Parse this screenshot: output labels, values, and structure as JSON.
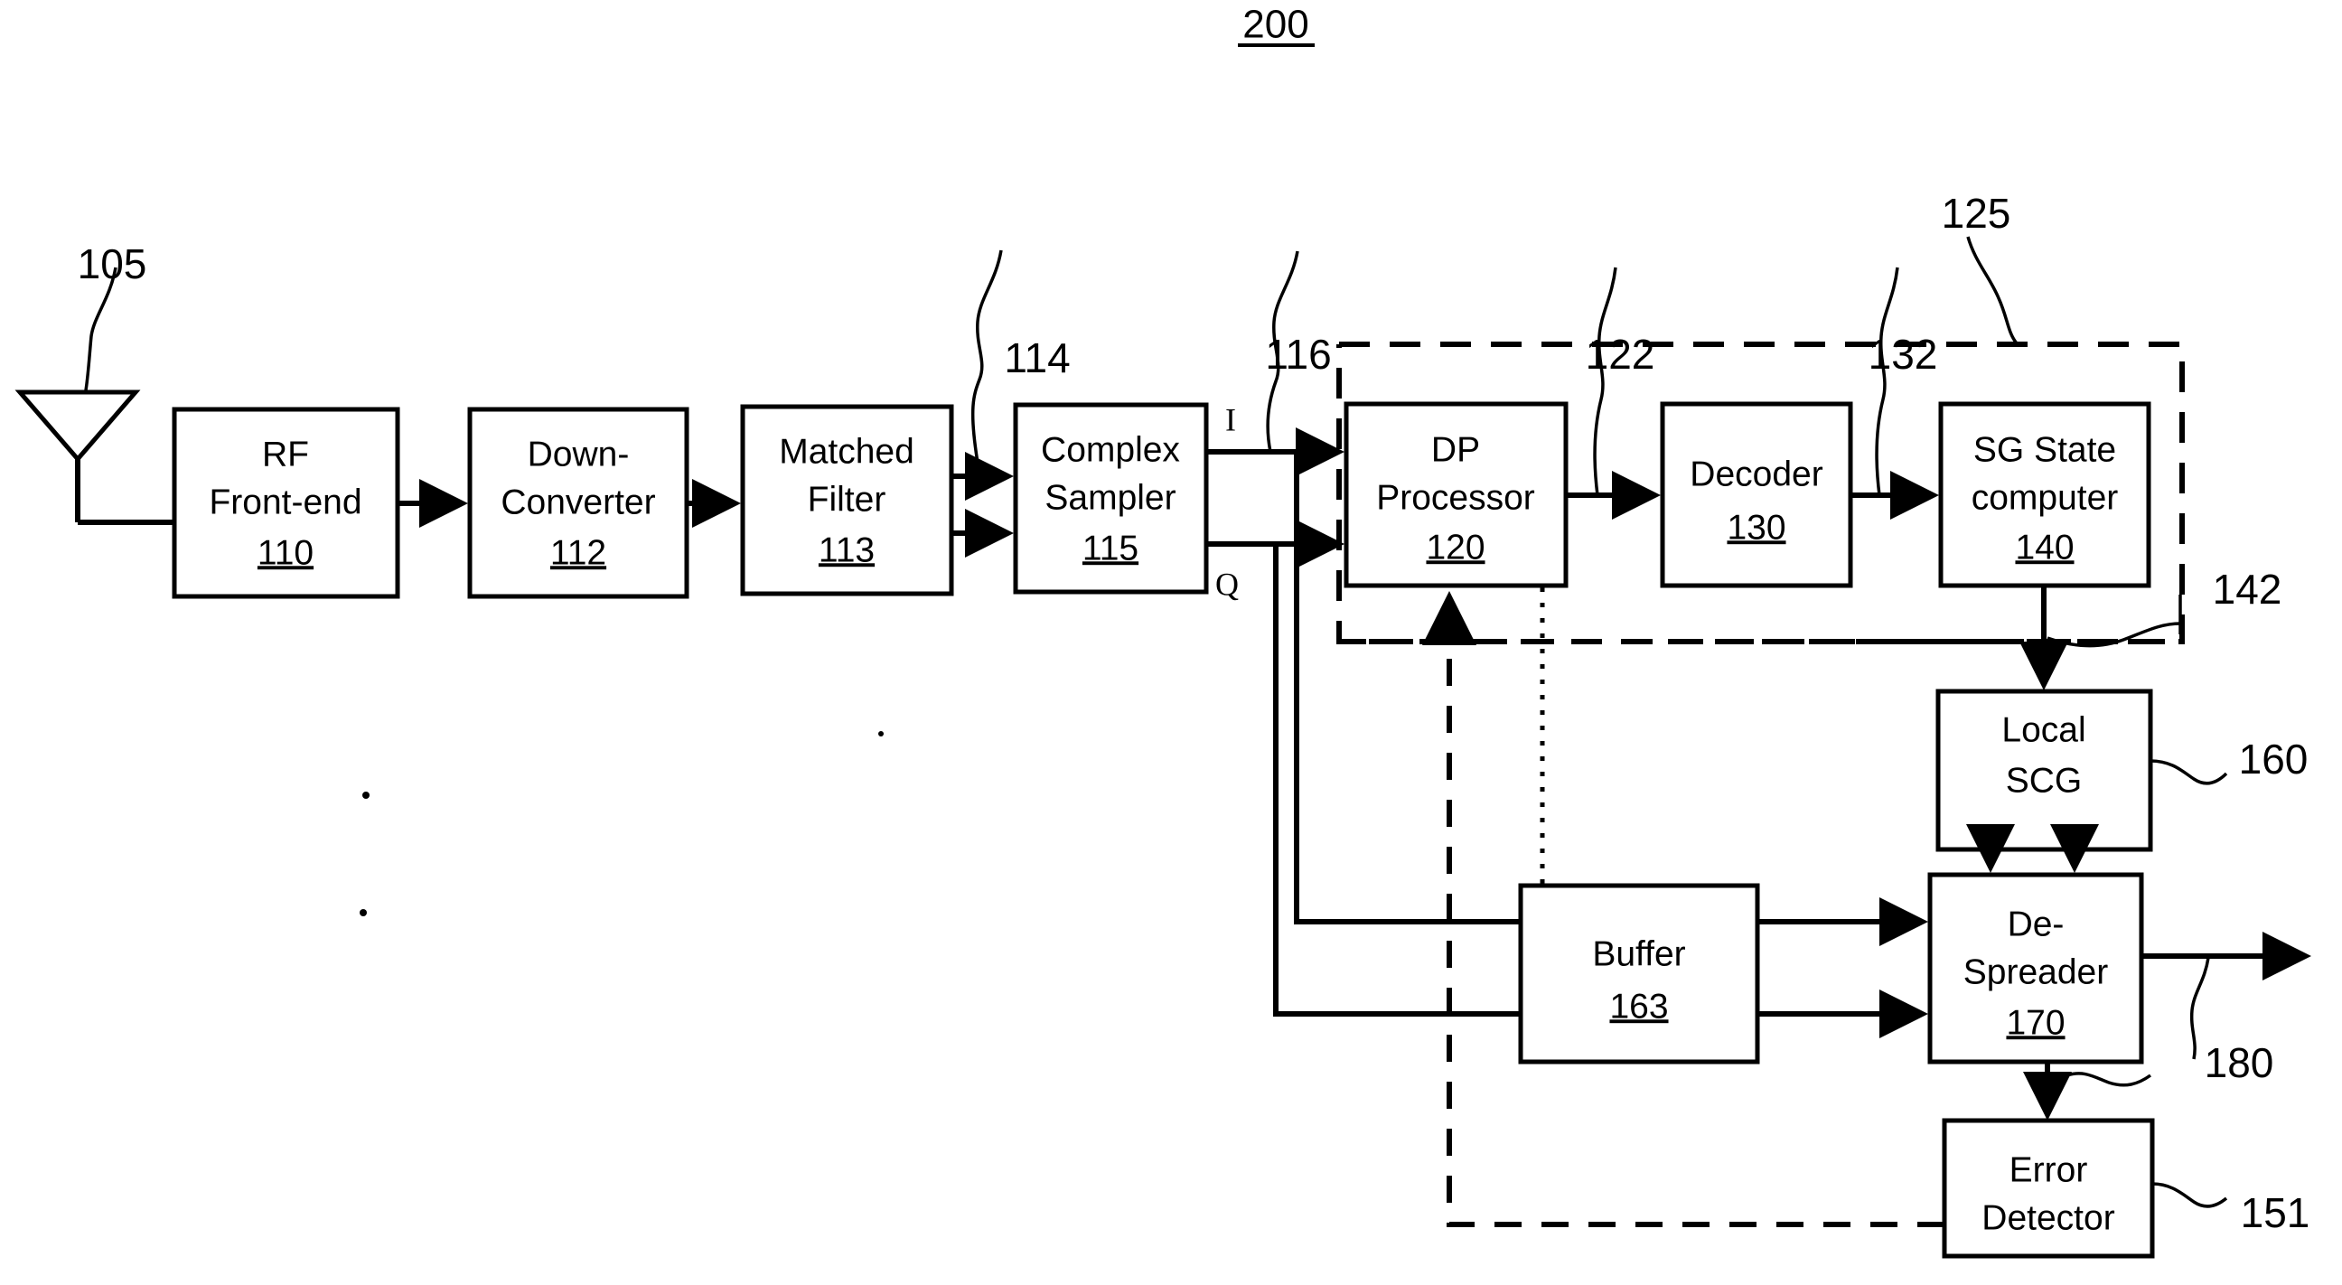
{
  "figure": {
    "title": "200",
    "title_underlined": true,
    "domain_note": "patent block diagram of a spread-spectrum receiver"
  },
  "blocks": [
    {
      "id": "rf-front-end",
      "line1": "RF",
      "line2": "Front-end",
      "ref": "110"
    },
    {
      "id": "down-converter",
      "line1": "Down-",
      "line2": "Converter",
      "ref": "112"
    },
    {
      "id": "matched-filter",
      "line1": "Matched",
      "line2": "Filter",
      "ref": "113"
    },
    {
      "id": "complex-sampler",
      "line1": "Complex",
      "line2": "Sampler",
      "ref": "115"
    },
    {
      "id": "dp-processor",
      "line1": "DP",
      "line2": "Processor",
      "ref": "120"
    },
    {
      "id": "decoder",
      "line1": "Decoder",
      "line2": "",
      "ref": "130"
    },
    {
      "id": "sg-state-computer",
      "line1": "SG State",
      "line2": "computer",
      "ref": "140"
    },
    {
      "id": "local-scg",
      "line1": "Local",
      "line2": "SCG",
      "ref": ""
    },
    {
      "id": "buffer",
      "line1": "Buffer",
      "line2": "",
      "ref": "163"
    },
    {
      "id": "de-spreader",
      "line1": "De-",
      "line2": "Spreader",
      "ref": "170"
    },
    {
      "id": "error-detector",
      "line1": "Error",
      "line2": "Detector",
      "ref": ""
    }
  ],
  "callouts": {
    "antenna": "105",
    "matched_filter_output": "114",
    "sampler_output": "116",
    "dashed_region": "125",
    "dp_to_decoder": "122",
    "decoder_to_sg": "132",
    "sg_to_local_scg": "142",
    "local_scg": "160",
    "despreader_output": "180",
    "error_detector": "151"
  },
  "signal_labels": {
    "inphase": "I",
    "quadrature": "Q"
  },
  "colors": {
    "ink": "#000000",
    "paper": "#ffffff"
  }
}
